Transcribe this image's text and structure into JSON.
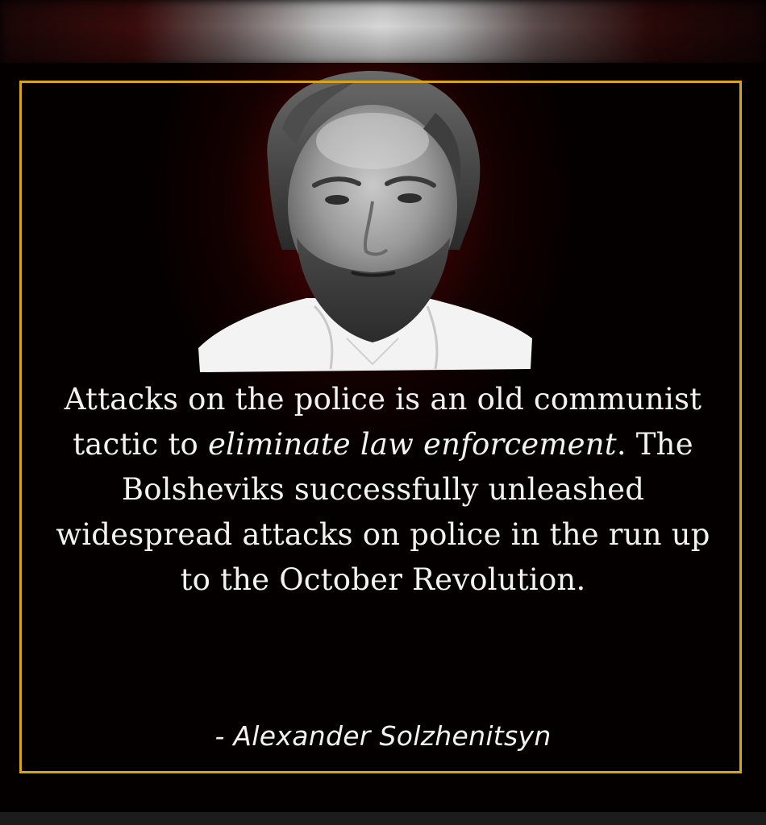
{
  "quote": {
    "part1": "Attacks on the police is an old communist tactic to ",
    "emphasis": "eliminate law enforcement",
    "part2": ". The Bolsheviks successfully unleashed widespread attacks on police in the run up to the October Revolution."
  },
  "attribution": "- Alexander Solzhenitsyn",
  "colors": {
    "frame": "#d8a419",
    "background_glow": "#5a0505",
    "text": "#f2f2f2"
  }
}
